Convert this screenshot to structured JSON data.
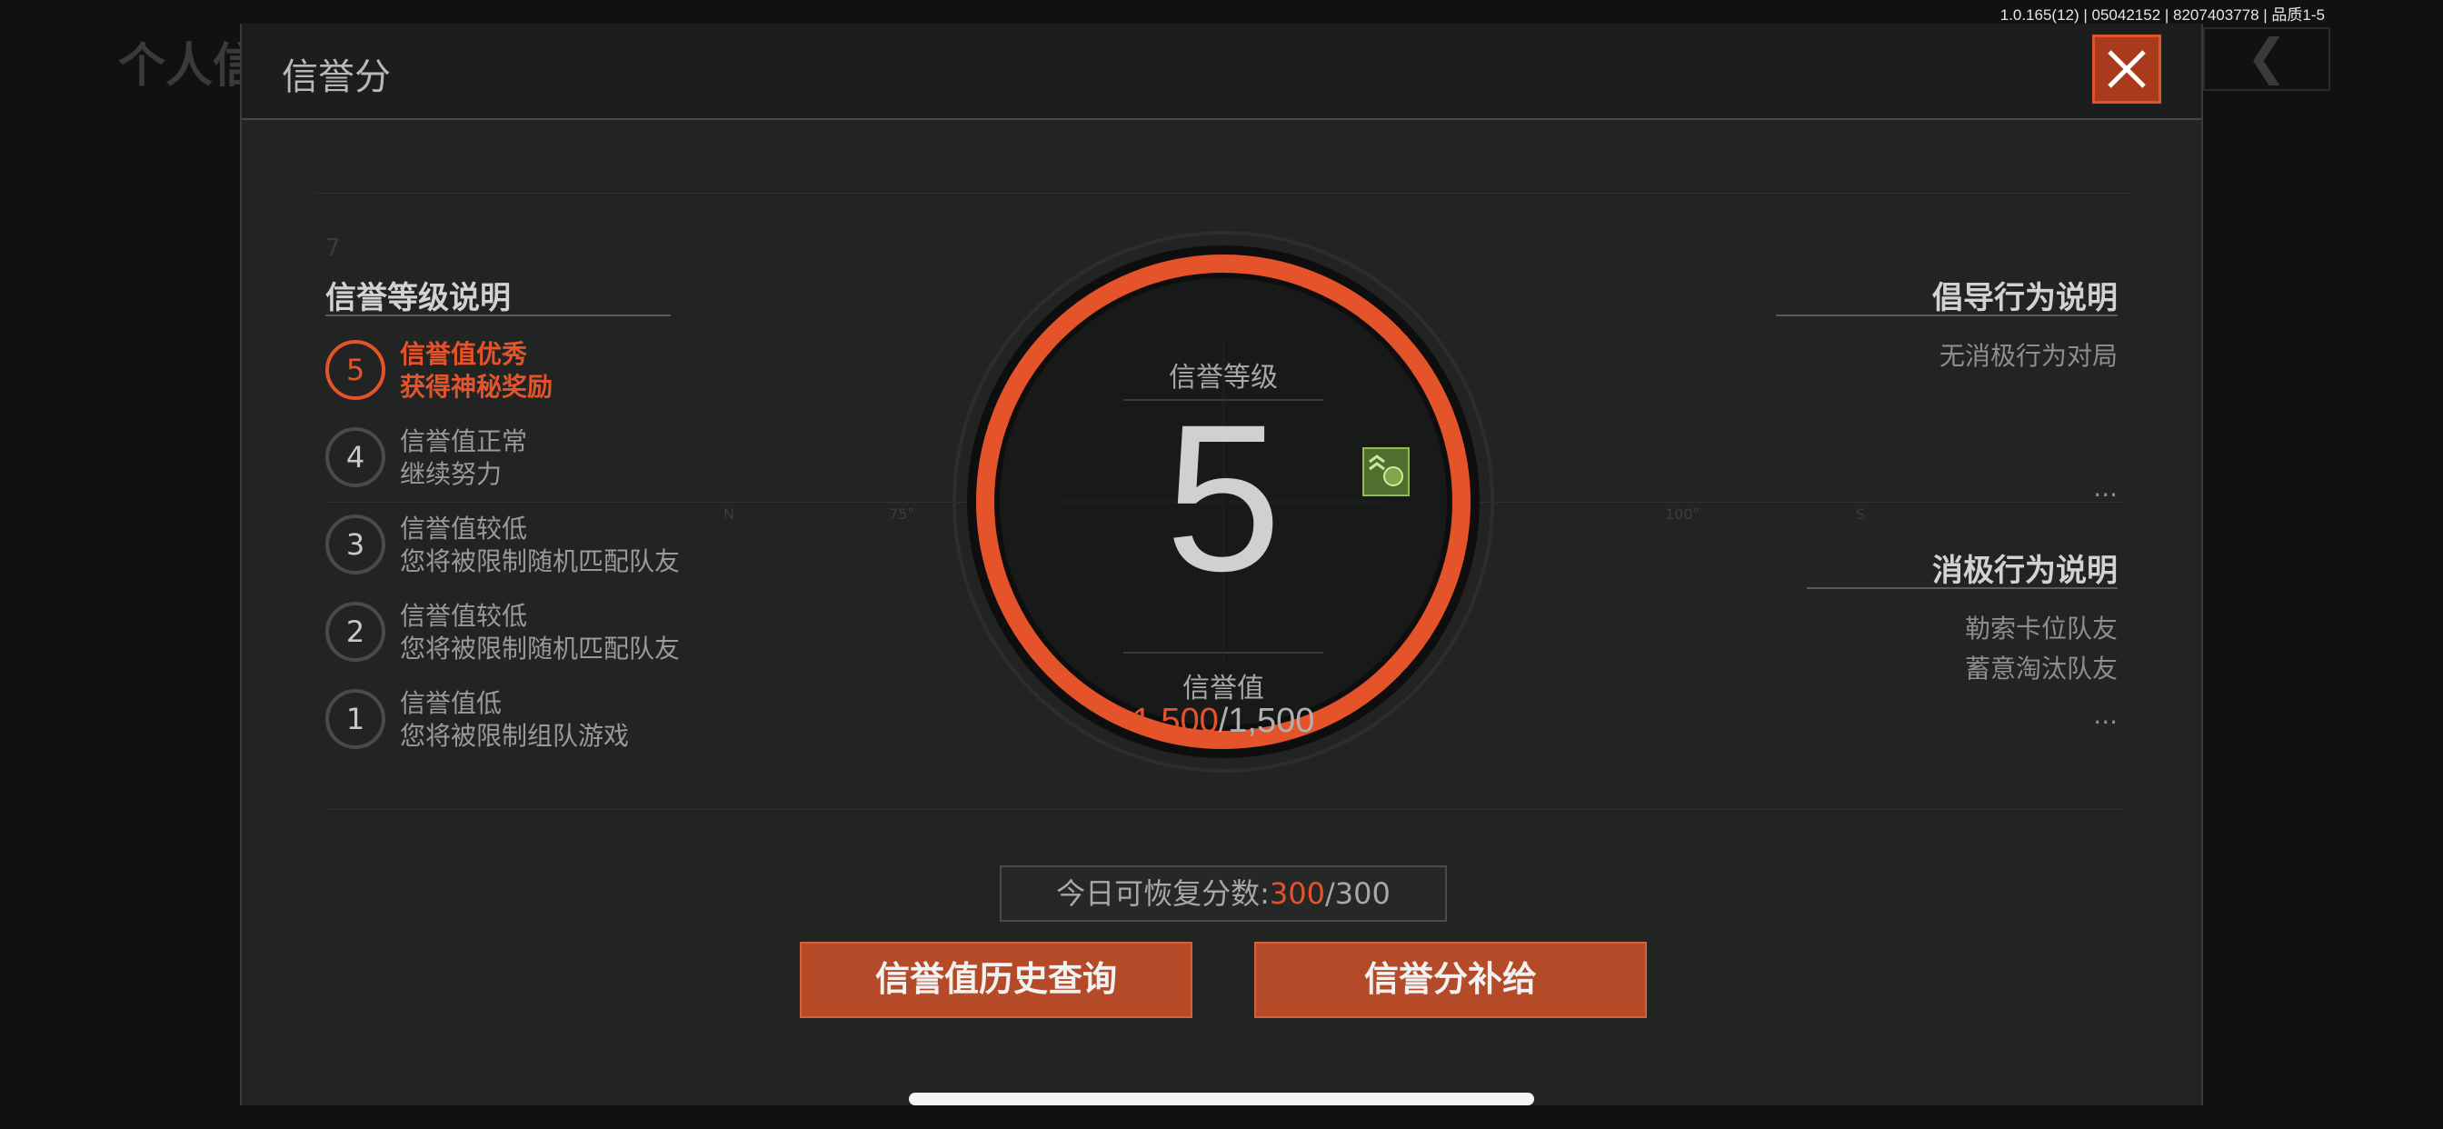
{
  "background": {
    "title": "个人信",
    "back_glyph": "❮"
  },
  "version_text": "1.0.165(12) | 05042152 | 8207403778 | 品质1-5",
  "dialog": {
    "title": "信誉分",
    "close_icon": "close-icon"
  },
  "levels": {
    "heading": "信誉等级说明",
    "items": [
      {
        "level": "5",
        "line1": "信誉值优秀",
        "line2": "获得神秘奖励",
        "active": true
      },
      {
        "level": "4",
        "line1": "信誉值正常",
        "line2": "继续努力",
        "active": false
      },
      {
        "level": "3",
        "line1": "信誉值较低",
        "line2": "您将被限制随机匹配队友",
        "active": false
      },
      {
        "level": "2",
        "line1": "信誉值较低",
        "line2": "您将被限制随机匹配队友",
        "active": false
      },
      {
        "level": "1",
        "line1": "信誉值低",
        "line2": "您将被限制组队游戏",
        "active": false
      }
    ]
  },
  "gauge": {
    "level_label": "信誉等级",
    "level_value": "5",
    "score_label": "信誉值",
    "score_current": "1,500",
    "score_max": "/1,500",
    "progress": 1.0,
    "accent_color": "#e5532a"
  },
  "advocated": {
    "heading": "倡导行为说明",
    "items": [
      "无消极行为对局"
    ],
    "more": "..."
  },
  "negative": {
    "heading": "消极行为说明",
    "items": [
      "勒索卡位队友",
      "蓄意淘汰队友"
    ],
    "more": "..."
  },
  "recover": {
    "label": "今日可恢复分数:",
    "current": "300",
    "max": "/300"
  },
  "buttons": {
    "history": "信誉值历史查询",
    "supply": "信誉分补给"
  },
  "decor": {
    "ticks": [
      "N",
      "75°",
      "100°",
      "S"
    ],
    "small_num": "7"
  }
}
